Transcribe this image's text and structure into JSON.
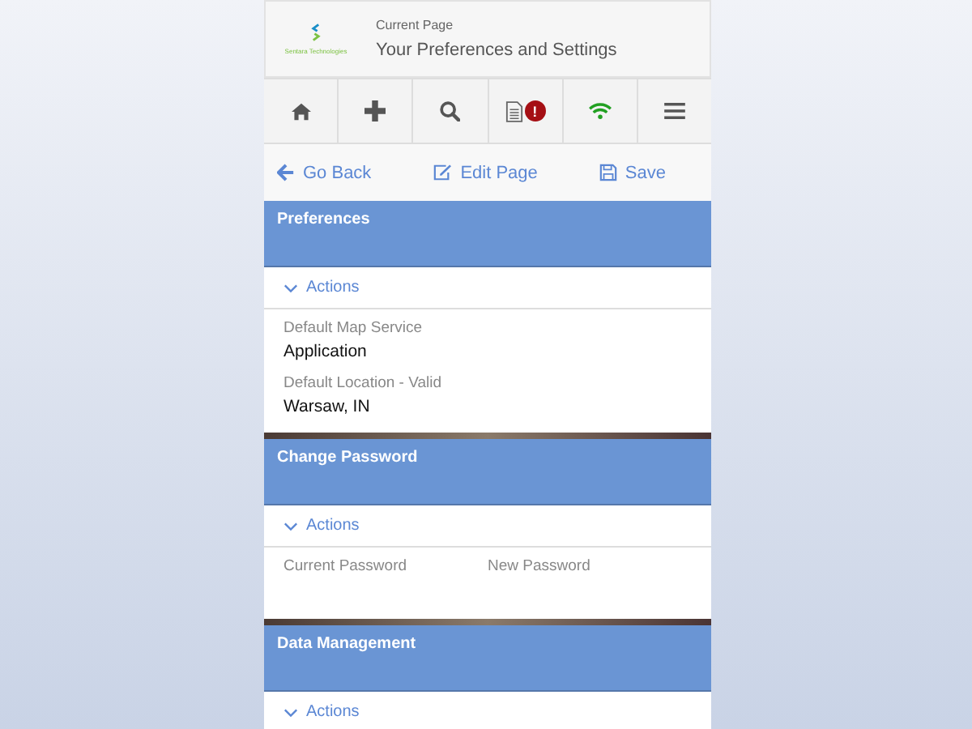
{
  "header": {
    "logo_text": "Sentara Technologies",
    "caption": "Current Page",
    "title": "Your Preferences and Settings"
  },
  "nav": [
    {
      "kind": "home"
    },
    {
      "kind": "plus"
    },
    {
      "kind": "search"
    },
    {
      "kind": "document",
      "badge": "!"
    },
    {
      "kind": "wifi"
    },
    {
      "kind": "menu"
    }
  ],
  "toolbar": [
    {
      "kind": "back",
      "label": "Go Back"
    },
    {
      "kind": "edit",
      "label": "Edit Page"
    },
    {
      "kind": "save",
      "label": "Save"
    }
  ],
  "sections": [
    {
      "title": "Preferences",
      "actions": "Actions",
      "kind": "stacked",
      "fields": [
        {
          "label": "Default Map Service",
          "value": "Application"
        },
        {
          "label": "Default Location - Valid",
          "value": "Warsaw, IN"
        }
      ]
    },
    {
      "title": "Change Password",
      "actions": "Actions",
      "kind": "columns",
      "fields": [
        {
          "label": "Current Password"
        },
        {
          "label": "New Password"
        }
      ]
    },
    {
      "title": "Data Management",
      "actions": "Actions"
    }
  ]
}
